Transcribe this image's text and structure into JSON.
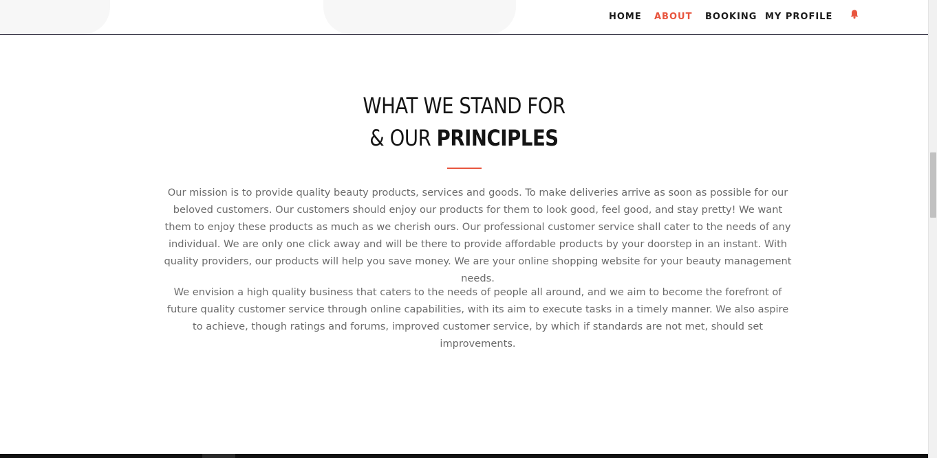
{
  "nav": {
    "items": [
      {
        "label": "HOME",
        "active": false
      },
      {
        "label": "ABOUT",
        "active": true
      },
      {
        "label": "BOOKING",
        "active": false
      },
      {
        "label": "MY PROFILE",
        "active": false
      }
    ],
    "notification_icon": "bell-icon"
  },
  "section": {
    "title_line1": "WHAT WE STAND FOR",
    "title_line2_prefix": "& OUR ",
    "title_line2_bold": "PRINCIPLES",
    "paragraph1": "Our mission is to provide quality beauty products, services and goods. To make deliveries arrive as soon as possible for our beloved customers. Our customers should enjoy our products for them to look good, feel good, and stay pretty! We want them to enjoy these products as much as we cherish ours. Our professional customer service shall cater to the needs of any individual. We are only one click away and will be there to provide affordable products by your doorstep in an instant. With quality providers, our products will help you save money. We are your online shopping website for your beauty management needs.",
    "paragraph2": "We envision a high quality business that caters to the needs of people all around, and we aim to become the forefront of future quality customer service through online capabilities, with its aim to execute tasks in a timely manner. We also aspire to achieve, though ratings and forums, improved customer service, by which if standards are not met, should set improvements."
  },
  "colors": {
    "accent": "#e8553e",
    "heading": "#141414",
    "body_text": "#6b6b6b"
  }
}
